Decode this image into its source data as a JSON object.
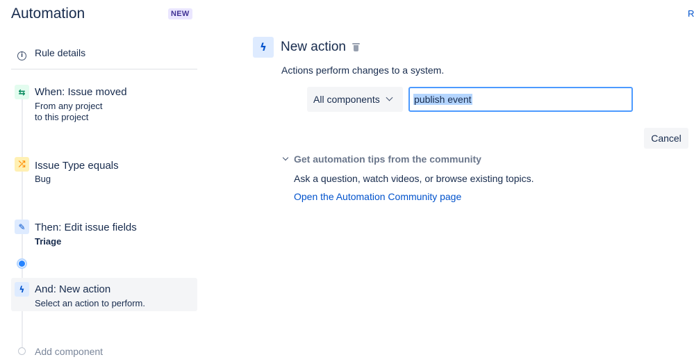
{
  "header": {
    "title": "Automation",
    "badge": "NEW",
    "edge_link": "R"
  },
  "sidebar": {
    "rule_details_label": "Rule details",
    "steps": [
      {
        "icon": "swap-arrows-icon",
        "title": "When: Issue moved",
        "subtitle": [
          "From any project",
          "to this project"
        ]
      },
      {
        "icon": "shuffle-icon",
        "title": "Issue Type equals",
        "subtitle": [
          "Bug"
        ]
      },
      {
        "icon": "pencil-icon",
        "title": "Then: Edit issue fields",
        "subtitle": [
          "Triage"
        ]
      },
      {
        "icon": "lightning-icon",
        "title": "And: New action",
        "subtitle": [
          "Select an action to perform."
        ]
      }
    ],
    "add_component_label": "Add component"
  },
  "main": {
    "title": "New action",
    "description": "Actions perform changes to a system.",
    "component_select": {
      "value": "All components"
    },
    "search": {
      "value": "publish event"
    },
    "cancel_label": "Cancel",
    "tips": {
      "title": "Get automation tips from the community",
      "body": "Ask a question, watch videos, or browse existing topics.",
      "link": "Open the Automation Community page"
    }
  },
  "colors": {
    "accent": "#0052cc",
    "focus_border": "#4c9aff",
    "trigger_bg": "#e3fcef",
    "condition_bg": "#fff0b3",
    "action_bg": "#deebff"
  }
}
